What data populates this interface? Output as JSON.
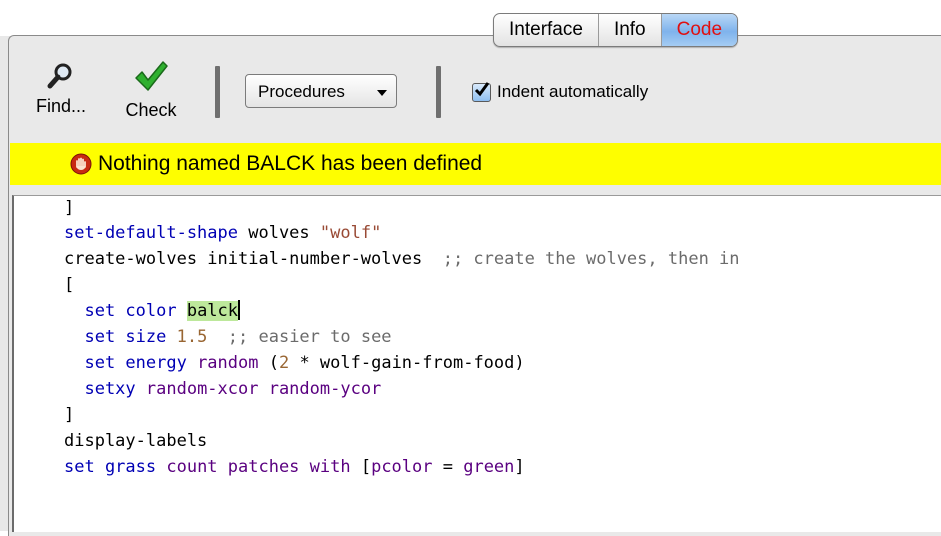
{
  "tabs": [
    {
      "label": "Interface"
    },
    {
      "label": "Info"
    },
    {
      "label": "Code",
      "active": true
    }
  ],
  "toolbar": {
    "find_label": "Find...",
    "check_label": "Check",
    "procedures_label": "Procedures",
    "indent_label": "Indent automatically",
    "indent_checked": true
  },
  "error": {
    "message": "Nothing named BALCK has been defined",
    "color": "#fefe00"
  },
  "icons": {
    "find": "magnifier-icon",
    "check": "green-checkmark-icon",
    "error": "stop-hand-icon"
  },
  "colors": {
    "active_tab_text": "#e01010",
    "highlight": "#bde89b",
    "keyword": "#0000b4",
    "reporter": "#5a0080"
  },
  "code": {
    "l0": "]",
    "l1a": "set-default-shape",
    "l1b": " wolves ",
    "l1c": "\"wolf\"",
    "l2a": "create-wolves initial-number-wolves  ",
    "l2b": ";; create the wolves, then in",
    "l3": "[",
    "l4a": "  set color ",
    "l4b": "balck",
    "l5a": "  set size ",
    "l5b": "1.5",
    "l5c": "  ;; easier to see",
    "l6a": "  set energy ",
    "l6b": "random",
    "l6c": " (",
    "l6d": "2",
    "l6e": " * wolf-gain-from-food)",
    "l7a": "  setxy ",
    "l7b": "random-xcor random-ycor",
    "l8": "]",
    "l9": "display-labels",
    "l10a": "set grass ",
    "l10b": "count patches with",
    "l10c": " [",
    "l10d": "pcolor",
    "l10e": " = ",
    "l10f": "green",
    "l10g": "]"
  }
}
